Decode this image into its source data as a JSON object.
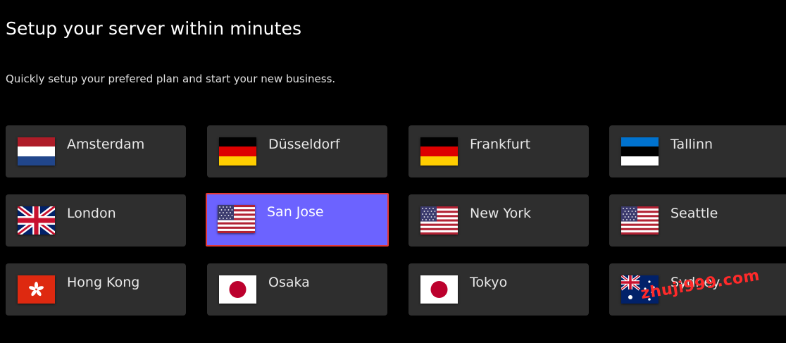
{
  "page": {
    "title": "Setup your server within minutes",
    "subtitle": "Quickly setup your prefered plan and start your new business."
  },
  "locations": [
    {
      "label": "Amsterdam",
      "flag": "netherlands-flag-icon",
      "selected": false
    },
    {
      "label": "Düsseldorf",
      "flag": "germany-flag-icon",
      "selected": false
    },
    {
      "label": "Frankfurt",
      "flag": "germany-flag-icon",
      "selected": false
    },
    {
      "label": "Tallinn",
      "flag": "estonia-flag-icon",
      "selected": false
    },
    {
      "label": "London",
      "flag": "uk-flag-icon",
      "selected": false
    },
    {
      "label": "San Jose",
      "flag": "usa-flag-icon",
      "selected": true
    },
    {
      "label": "New York",
      "flag": "usa-flag-icon",
      "selected": false
    },
    {
      "label": "Seattle",
      "flag": "usa-flag-icon",
      "selected": false
    },
    {
      "label": "Hong Kong",
      "flag": "hong-kong-flag-icon",
      "selected": false
    },
    {
      "label": "Osaka",
      "flag": "japan-flag-icon",
      "selected": false
    },
    {
      "label": "Tokyo",
      "flag": "japan-flag-icon",
      "selected": false
    },
    {
      "label": "Sydney",
      "flag": "australia-flag-icon",
      "selected": false
    }
  ],
  "watermark": "zhuji999.com",
  "colors": {
    "card_bg": "#2e2e2e",
    "selected_bg": "#6c63ff",
    "selected_border": "#e53935",
    "watermark": "#ff2a2a"
  }
}
